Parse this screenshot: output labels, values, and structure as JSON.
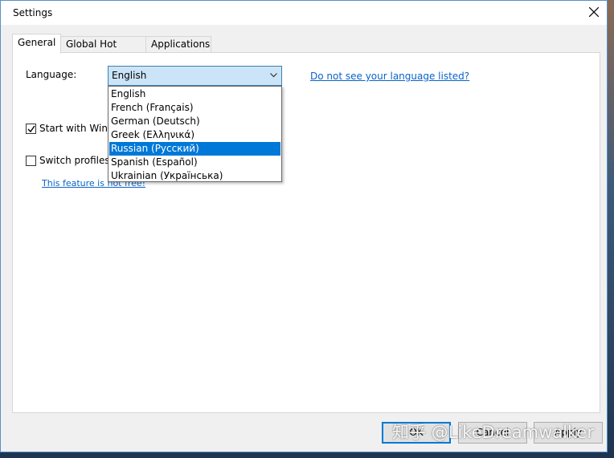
{
  "window": {
    "title": "Settings"
  },
  "tabs": [
    "General",
    "Global Hot Keys",
    "Applications"
  ],
  "general": {
    "language_label": "Language:",
    "language_value": "English",
    "language_link": "Do not see your language listed?",
    "start_with_windows": "Start with Windows",
    "switch_profiles": "Switch profiles",
    "feature_link": "This feature is not free!"
  },
  "dropdown": {
    "options": [
      "English",
      "French (Français)",
      "German (Deutsch)",
      "Greek (Ελληνικά)",
      "Russian (Русский)",
      "Spanish (Español)",
      "Ukrainian (Українська)"
    ],
    "highlighted": "Russian (Русский)"
  },
  "buttons": {
    "ok": "OK",
    "cancel": "Cancel",
    "apply": "Apply"
  },
  "watermark": "知乎 @LikeDreamwalker",
  "colors": {
    "accent": "#0078d7",
    "link": "#0a63c8",
    "combo_bg": "#cce4f7"
  }
}
